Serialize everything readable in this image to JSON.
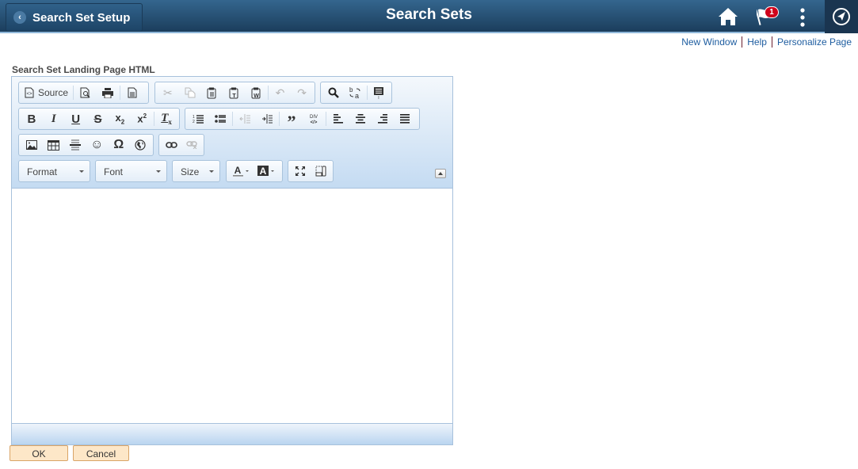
{
  "header": {
    "back_label": "Search Set Setup",
    "title": "Search Sets",
    "notification_count": "1",
    "icons": [
      "home-icon",
      "notification-flag-icon",
      "actions-menu-icon",
      "navbar-compass-icon"
    ]
  },
  "top_links": {
    "new_window": "New Window",
    "help": "Help",
    "personalize": "Personalize Page"
  },
  "field": {
    "label": "Search Set Landing Page HTML",
    "content": ""
  },
  "editor": {
    "source_label": "Source",
    "format_label": "Format",
    "font_label": "Font",
    "size_label": "Size",
    "toolbar_groups": [
      [
        "source",
        "preview",
        "print",
        "templates"
      ],
      [
        "cut",
        "copy",
        "paste",
        "paste-text",
        "paste-from-word",
        "undo",
        "redo"
      ],
      [
        "find",
        "replace",
        "select-all"
      ],
      [
        "bold",
        "italic",
        "underline",
        "strikethrough",
        "subscript",
        "superscript",
        "remove-format"
      ],
      [
        "numbered-list",
        "bulleted-list",
        "outdent",
        "indent",
        "blockquote",
        "create-div",
        "align-left",
        "align-center",
        "align-right",
        "justify"
      ],
      [
        "image",
        "table",
        "horizontal-line",
        "smiley",
        "special-char",
        "iframe"
      ],
      [
        "link",
        "unlink"
      ],
      [
        "text-color",
        "background-color"
      ],
      [
        "maximize",
        "show-blocks"
      ]
    ],
    "disabled_tools": [
      "cut",
      "copy",
      "undo",
      "redo",
      "outdent",
      "unlink"
    ]
  },
  "buttons": {
    "ok": "OK",
    "cancel": "Cancel"
  }
}
